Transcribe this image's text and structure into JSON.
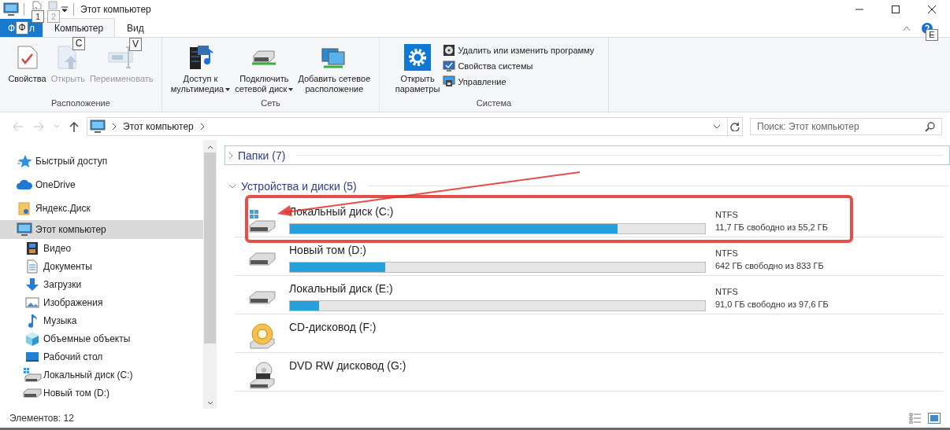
{
  "window": {
    "title": "Этот компьютер",
    "quick_access_keytips": [
      "1",
      "2"
    ]
  },
  "ribbon": {
    "file_tab": {
      "label_start": "Ф",
      "keytip": "Ф",
      "label_end": "л"
    },
    "tabs": [
      {
        "label": "Компьютер",
        "keytip": "C",
        "selected": true
      },
      {
        "label": "Вид",
        "keytip": "V",
        "selected": false
      }
    ],
    "help_keytip": "E",
    "groups": [
      {
        "label": "Расположение",
        "buttons": [
          {
            "kind": "properties",
            "label": "Свойства",
            "disabled": false,
            "dropdown": false
          },
          {
            "kind": "open",
            "label": "Открыть",
            "disabled": true,
            "dropdown": false
          },
          {
            "kind": "rename",
            "label": "Переименовать",
            "disabled": true,
            "dropdown": false
          }
        ]
      },
      {
        "label": "Сеть",
        "buttons": [
          {
            "kind": "media",
            "label": "Доступ к\nмультимедиа",
            "disabled": false,
            "dropdown": true
          },
          {
            "kind": "netdrive",
            "label": "Подключить\nсетевой диск",
            "disabled": false,
            "dropdown": true
          },
          {
            "kind": "netplace",
            "label": "Добавить сетевое\nрасположение",
            "disabled": false,
            "dropdown": false
          }
        ]
      },
      {
        "label": "Система",
        "buttons": [
          {
            "kind": "settings",
            "label": "Открыть\nпараметры",
            "disabled": false,
            "dropdown": false
          }
        ],
        "small_buttons": [
          {
            "kind": "uninstall",
            "label": "Удалить или изменить программу"
          },
          {
            "kind": "sysprops",
            "label": "Свойства системы"
          },
          {
            "kind": "manage",
            "label": "Управление"
          }
        ]
      }
    ]
  },
  "address_bar": {
    "path": [
      "Этот компьютер"
    ],
    "search_placeholder": "Поиск: Этот компьютер"
  },
  "nav_pane": {
    "items": [
      {
        "kind": "quick",
        "label": "Быстрый доступ",
        "selected": false
      },
      {
        "kind": "onedrive",
        "label": "OneDrive",
        "selected": false
      },
      {
        "kind": "yandex",
        "label": "Яндекс.Диск",
        "selected": false
      },
      {
        "kind": "pc",
        "label": "Этот компьютер",
        "selected": true,
        "children": [
          {
            "kind": "video",
            "label": "Видео",
            "selected": false
          },
          {
            "kind": "docs",
            "label": "Документы",
            "selected": false
          },
          {
            "kind": "downloads",
            "label": "Загрузки",
            "selected": false
          },
          {
            "kind": "pictures",
            "label": "Изображения",
            "selected": false
          },
          {
            "kind": "music",
            "label": "Музыка",
            "selected": false
          },
          {
            "kind": "objects",
            "label": "Объемные объекты",
            "selected": false
          },
          {
            "kind": "desktop",
            "label": "Рабочий стол",
            "selected": false
          },
          {
            "kind": "sysdisk",
            "label": "Локальный диск (C:)",
            "selected": false
          },
          {
            "kind": "disk",
            "label": "Новый том (D:)",
            "selected": false
          }
        ]
      }
    ]
  },
  "groups": [
    {
      "label": "Папки (7)",
      "expanded": false
    },
    {
      "label": "Устройства и диски (5)",
      "expanded": true
    }
  ],
  "drives": [
    {
      "kind": "system-disk",
      "highlighted": true,
      "name": "Локальный диск (C:)",
      "level": 0.79,
      "filesystem": "NTFS",
      "free": "11,7 ГБ свободно из 55,2 ГБ"
    },
    {
      "kind": "disk",
      "highlighted": false,
      "name": "Новый том (D:)",
      "level": 0.23,
      "filesystem": "NTFS",
      "free": "642 ГБ свободно из 833 ГБ"
    },
    {
      "kind": "disk",
      "highlighted": false,
      "name": "Локальный диск (E:)",
      "level": 0.07,
      "filesystem": "NTFS",
      "free": "91,0 ГБ свободно из 97,6 ГБ"
    },
    {
      "kind": "cd",
      "highlighted": false,
      "name": "CD-дисковод (F:)"
    },
    {
      "kind": "dvd",
      "highlighted": false,
      "name": "DVD RW дисковод (G:)"
    }
  ],
  "status_bar": {
    "item_count": "Элементов: 12"
  }
}
